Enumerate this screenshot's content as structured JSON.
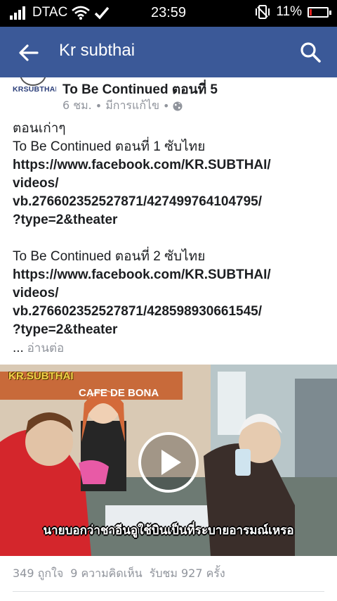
{
  "status_bar": {
    "carrier": "DTAC",
    "time": "23:59",
    "battery_percent_label": "11%",
    "battery_level": 0.11,
    "battery_color": "#e0201e"
  },
  "app_bar": {
    "title": "Kr  subthai",
    "color": "#3b5998",
    "back_icon": "arrow-left-icon",
    "search_icon": "search-icon"
  },
  "post": {
    "page_logo_text": "KRSUBTHAI",
    "page_name": "To Be Continued ตอนที่ 5",
    "time_ago": "6 ชม.",
    "edited": "มีการแก้ไข",
    "privacy_icon": "globe-icon",
    "lines": {
      "l1": "ตอนเก่าๆ",
      "l2": "To Be Continued ตอนที่ 1 ซับไทย",
      "l3": "https://www.facebook.com/KR.SUBTHAI/",
      "l4": "videos/",
      "l5": "vb.276602352527871/427499764104795/",
      "l6": "?type=2&theater",
      "l7": "To Be Continued ตอนที่ 2 ซับไทย",
      "l8": "https://www.facebook.com/KR.SUBTHAI/",
      "l9": "videos/",
      "l10": "vb.276602352527871/428598930661545/",
      "l11": "?type=2&theater"
    },
    "see_more_dots": "...",
    "see_more": "อ่านต่อ"
  },
  "video": {
    "watermark": "KR.SUBTHAI",
    "shop_sign": "CAFE DE BONA",
    "subtitle": "นายบอกว่าชาอีนอูใช้บินเป็นที่ระบายอารมณ์เหรอ",
    "play_icon": "play-icon"
  },
  "stats": {
    "likes": "349 ถูกใจ",
    "comments": "9 ความคิดเห็น",
    "views": "รับชม 927 ครั้ง"
  }
}
